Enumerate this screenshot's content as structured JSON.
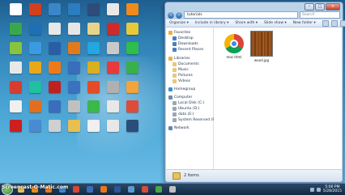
{
  "window": {
    "address": "tutorials",
    "search_placeholder": "Search",
    "command_bar": [
      "Organize",
      "Include in library",
      "Share with",
      "Slide show",
      "New folder"
    ],
    "nav_items": [
      {
        "label": "Favorites",
        "indent": 0,
        "color": "#e7b43a"
      },
      {
        "label": "Desktop",
        "indent": 1,
        "color": "#4a7fc0"
      },
      {
        "label": "Downloads",
        "indent": 1,
        "color": "#4a7fc0"
      },
      {
        "label": "Recent Places",
        "indent": 1,
        "color": "#4a7fc0"
      },
      {
        "label": "Libraries",
        "indent": 0,
        "color": "#e7b43a"
      },
      {
        "label": "Documents",
        "indent": 1,
        "color": "#e7c87a"
      },
      {
        "label": "Music",
        "indent": 1,
        "color": "#e7c87a"
      },
      {
        "label": "Pictures",
        "indent": 1,
        "color": "#e7c87a"
      },
      {
        "label": "Videos",
        "indent": 1,
        "color": "#e7c87a"
      },
      {
        "label": "Homegroup",
        "indent": 0,
        "color": "#3a8fd1"
      },
      {
        "label": "Computer",
        "indent": 0,
        "color": "#6f8aa8"
      },
      {
        "label": "Local Disk (C:)",
        "indent": 1,
        "color": "#9aa7b6"
      },
      {
        "label": "Ubuntu (D:)",
        "indent": 1,
        "color": "#9aa7b6"
      },
      {
        "label": "data (E:)",
        "indent": 1,
        "color": "#9aa7b6"
      },
      {
        "label": "System Reserved (F:)",
        "indent": 1,
        "color": "#9aa7b6"
      },
      {
        "label": "Network",
        "indent": 0,
        "color": "#5a88b8"
      }
    ],
    "files": [
      {
        "name": "mac.html",
        "kind": "chrome"
      },
      {
        "name": "wood.jpg",
        "kind": "wood"
      }
    ],
    "status": "2 items"
  },
  "desktop_icons": [
    {
      "label": "",
      "color": "#ffffff"
    },
    {
      "label": "",
      "color": "#d0401f"
    },
    {
      "label": "",
      "color": "#3a86c8"
    },
    {
      "label": "",
      "color": "#2c7cc0"
    },
    {
      "label": "",
      "color": "#2e4c7a"
    },
    {
      "label": "",
      "color": "#e8e8e8"
    },
    {
      "label": "",
      "color": "#f08a1c"
    },
    {
      "label": "",
      "color": "#3aa84a"
    },
    {
      "label": "",
      "color": "#1f6fb4"
    },
    {
      "label": "",
      "color": "#e8e8e8"
    },
    {
      "label": "",
      "color": "#e6e6e6"
    },
    {
      "label": "",
      "color": "#e8d38a"
    },
    {
      "label": "",
      "color": "#cf2a2a"
    },
    {
      "label": "",
      "color": "#e7c93a"
    },
    {
      "label": "",
      "color": "#8ac43f"
    },
    {
      "label": "",
      "color": "#3a9be0"
    },
    {
      "label": "",
      "color": "#2a5da8"
    },
    {
      "label": "",
      "color": "#e27a1c"
    },
    {
      "label": "",
      "color": "#21a8e0"
    },
    {
      "label": "",
      "color": "#c9c9c9"
    },
    {
      "label": "",
      "color": "#2dbf4a"
    },
    {
      "label": "",
      "color": "#e8e8e8"
    },
    {
      "label": "",
      "color": "#e8a81c"
    },
    {
      "label": "",
      "color": "#f07a18"
    },
    {
      "label": "",
      "color": "#3a6dbb"
    },
    {
      "label": "",
      "color": "#d8b020"
    },
    {
      "label": "",
      "color": "#e83a3a"
    },
    {
      "label": "",
      "color": "#3ab04a"
    },
    {
      "label": "",
      "color": "#d73d2e"
    },
    {
      "label": "",
      "color": "#20c0a0"
    },
    {
      "label": "",
      "color": "#c02020"
    },
    {
      "label": "",
      "color": "#3a72c0"
    },
    {
      "label": "",
      "color": "#e34c26"
    },
    {
      "label": "",
      "color": "#b0b0b0"
    },
    {
      "label": "",
      "color": "#f2a33a"
    },
    {
      "label": "",
      "color": "#f0f0f0"
    },
    {
      "label": "",
      "color": "#e07020"
    },
    {
      "label": "",
      "color": "#3a6dbb"
    },
    {
      "label": "",
      "color": "#c0c0c0"
    },
    {
      "label": "",
      "color": "#3ab84a"
    },
    {
      "label": "",
      "color": "#e8e8e8"
    },
    {
      "label": "",
      "color": "#dd4b39"
    },
    {
      "label": "",
      "color": "#cc2020"
    },
    {
      "label": "",
      "color": "#4a8ad0"
    },
    {
      "label": "",
      "color": "#d0d0d0"
    },
    {
      "label": "",
      "color": "#e8c050"
    },
    {
      "label": "",
      "color": "#f0f0f0"
    },
    {
      "label": "",
      "color": "#e8e8e8"
    },
    {
      "label": "",
      "color": "#2b4d7a"
    }
  ],
  "taskbar": {
    "pinned": [
      {
        "name": "explorer",
        "color": "#e7c05a"
      },
      {
        "name": "media-player",
        "color": "#f08a1c"
      },
      {
        "name": "vlc",
        "color": "#f07a18"
      },
      {
        "name": "paint",
        "color": "#3a8ad0"
      },
      {
        "name": "chrome",
        "color": "#db4437"
      },
      {
        "name": "app",
        "color": "#3a6dbb"
      },
      {
        "name": "firefox",
        "color": "#e8771c"
      },
      {
        "name": "word",
        "color": "#2b579a"
      },
      {
        "name": "app2",
        "color": "#5a9ad0"
      },
      {
        "name": "app3",
        "color": "#d84a3a"
      },
      {
        "name": "app4",
        "color": "#4aa84a"
      },
      {
        "name": "app5",
        "color": "#c0c0c0"
      }
    ],
    "time": "5:00 PM",
    "date": "5/28/2015"
  },
  "watermark": "Screencast-O-Matic.com"
}
